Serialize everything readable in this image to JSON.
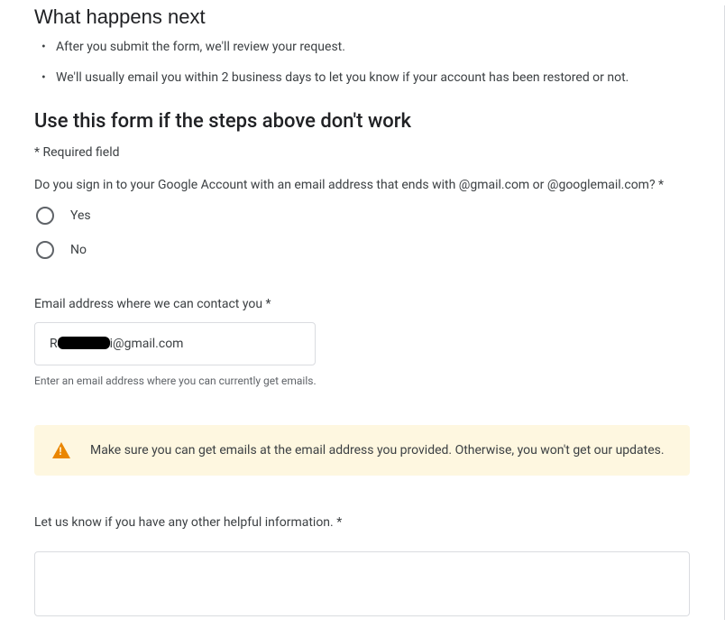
{
  "section_next": {
    "heading": "What happens next",
    "bullets": [
      "After you submit the form, we'll review your request.",
      "We'll usually email you within 2 business days to let you know if your account has been restored or not."
    ]
  },
  "section_form": {
    "heading": "Use this form if the steps above don't work",
    "required_note": "* Required field",
    "q_signin": {
      "text": "Do you sign in to your Google Account with an email address that ends with @gmail.com or @googlemail.com? *",
      "options": {
        "yes": "Yes",
        "no": "No"
      }
    },
    "contact_email": {
      "label": "Email address where we can contact you *",
      "value_prefix": "R",
      "value_suffix": "i@gmail.com",
      "helper": "Enter an email address where you can currently get emails."
    },
    "warning": {
      "text": "Make sure you can get emails at the email address you provided. Otherwise, you won't get our updates."
    },
    "extra_info": {
      "label": "Let us know if you have any other helpful information. *",
      "value": ""
    }
  }
}
